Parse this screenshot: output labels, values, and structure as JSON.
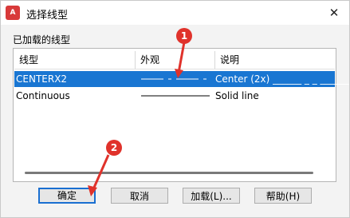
{
  "window": {
    "title": "选择线型",
    "app_icon_text": "A\nCAD",
    "close_symbol": "✕"
  },
  "group_label": "已加载的线型",
  "table": {
    "columns": [
      "线型",
      "外观",
      "说明"
    ],
    "rows": [
      {
        "name": "CENTERX2",
        "appearance": "centerline-dash-dot",
        "description": "Center (2x) ______ _ _ ______",
        "selected": true
      },
      {
        "name": "Continuous",
        "appearance": "solid-line",
        "description": "Solid line",
        "selected": false
      }
    ]
  },
  "buttons": {
    "ok": "确定",
    "cancel": "取消",
    "load": "加载(L)...",
    "help": "帮助(H)"
  },
  "annotations": [
    "1",
    "2"
  ],
  "colors": {
    "selection": "#1976d2",
    "badge": "#e0322b",
    "primary_border": "#1a6fd1"
  }
}
